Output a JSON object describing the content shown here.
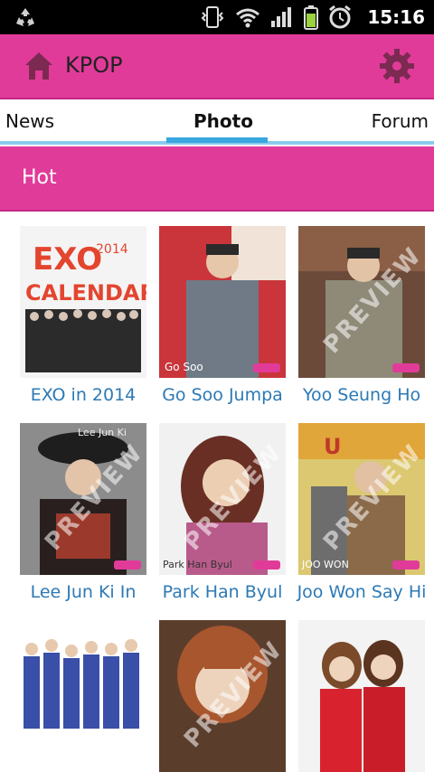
{
  "status_bar": {
    "time": "15:16"
  },
  "app_bar": {
    "title": "KPOP"
  },
  "tabs": [
    {
      "label": "News"
    },
    {
      "label": "Photo"
    },
    {
      "label": "Forum"
    }
  ],
  "section": {
    "label": "Hot"
  },
  "items": [
    {
      "caption": "EXO in 2014"
    },
    {
      "caption": "Go Soo Jumpa"
    },
    {
      "caption": "Yoo Seung Ho"
    },
    {
      "caption": "Lee Jun Ki In"
    },
    {
      "caption": "Park Han Byul"
    },
    {
      "caption": "Joo Won Say Hi"
    },
    {
      "caption": ""
    },
    {
      "caption": ""
    },
    {
      "caption": ""
    }
  ]
}
